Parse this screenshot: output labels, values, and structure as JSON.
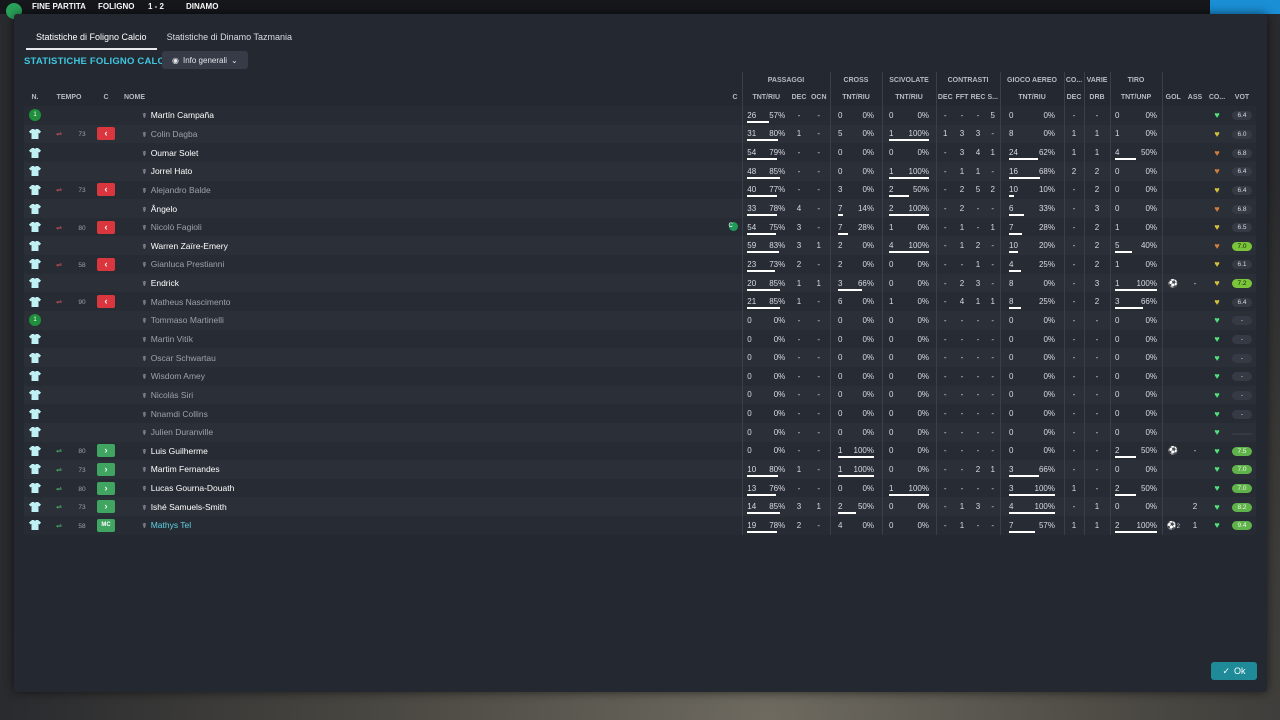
{
  "topbar": {
    "status": "FINE PARTITA",
    "home": "FOLIGNO",
    "score": "1 - 2",
    "away": "DINAMO"
  },
  "tabs": [
    {
      "label": "Statistiche di Foligno Calcio",
      "active": true
    },
    {
      "label": "Statistiche di Dinamo Tazmania",
      "active": false
    }
  ],
  "section_title": "STATISTICHE FOLIGNO CALCIO",
  "dropdown": {
    "label": "Info generali"
  },
  "groups": [
    "PASSAGGI",
    "CROSS",
    "SCIVOLATE",
    "CONTRASTI",
    "GIOCO AEREO",
    "CO...",
    "VARIE",
    "TIRO"
  ],
  "headers": {
    "n": "N.",
    "tempo": "TEMPO",
    "c": "C",
    "nome": "NOME",
    "c2": "C",
    "tnt_riu": "TNT/RIU",
    "dec": "DEC",
    "ocn": "OCN",
    "fft": "FFT",
    "rec": "REC",
    "s": "S...",
    "tnt_riu2": "TNT/RIU",
    "dec2": "DEC",
    "drb": "DRB",
    "tnt_unp": "TNT/UNP",
    "gol": "GOL",
    "ass": "ASS",
    "co": "CO...",
    "vot": "VOT"
  },
  "players": [
    {
      "n": "1",
      "gk": true,
      "tempo": "",
      "sub": "",
      "name": "Martín Campaña",
      "dim": false,
      "pt": "26",
      "pp": "57%",
      "pb": 0.57,
      "pdec": "-",
      "pocn": "-",
      "ct": "0",
      "cp": "0%",
      "cb": 0,
      "st": "0",
      "sp": "0%",
      "sb": 0,
      "cdec": "-",
      "cfft": "-",
      "crec": "-",
      "cs": "5",
      "at": "0",
      "ap": "0%",
      "ab": 0,
      "codec": "-",
      "drb": "-",
      "tt": "0",
      "tp": "0%",
      "tb": 0,
      "gol": "-",
      "ass": "",
      "co": "green",
      "vot": "6.4",
      "vcls": ""
    },
    {
      "n": "",
      "gk": false,
      "tempo": "73",
      "sub": "out",
      "name": "Colin Dagba",
      "dim": true,
      "pt": "31",
      "pp": "80%",
      "pb": 0.8,
      "pdec": "1",
      "pocn": "-",
      "ct": "5",
      "cp": "0%",
      "cb": 0,
      "st": "1",
      "sp": "100%",
      "sb": 1,
      "cdec": "1",
      "cfft": "3",
      "crec": "3",
      "cs": "-",
      "at": "8",
      "ap": "0%",
      "ab": 0,
      "codec": "1",
      "drb": "1",
      "tt": "1",
      "tp": "0%",
      "tb": 0,
      "gol": "-",
      "ass": "",
      "co": "yellow",
      "vot": "6.0",
      "vcls": ""
    },
    {
      "n": "",
      "gk": false,
      "tempo": "",
      "sub": "",
      "name": "Oumar Solet",
      "dim": false,
      "pt": "54",
      "pp": "79%",
      "pb": 0.79,
      "pdec": "-",
      "pocn": "-",
      "ct": "0",
      "cp": "0%",
      "cb": 0,
      "st": "0",
      "sp": "0%",
      "sb": 0,
      "cdec": "-",
      "cfft": "3",
      "crec": "4",
      "cs": "1",
      "at": "24",
      "ap": "62%",
      "ab": 0.62,
      "codec": "1",
      "drb": "1",
      "tt": "4",
      "tp": "50%",
      "tb": 0.5,
      "gol": "-",
      "ass": "",
      "co": "orange",
      "vot": "6.8",
      "vcls": ""
    },
    {
      "n": "",
      "gk": false,
      "tempo": "",
      "sub": "",
      "name": "Jorrel Hato",
      "dim": false,
      "pt": "48",
      "pp": "85%",
      "pb": 0.85,
      "pdec": "-",
      "pocn": "-",
      "ct": "0",
      "cp": "0%",
      "cb": 0,
      "st": "1",
      "sp": "100%",
      "sb": 1,
      "cdec": "-",
      "cfft": "1",
      "crec": "1",
      "cs": "-",
      "at": "16",
      "ap": "68%",
      "ab": 0.68,
      "codec": "2",
      "drb": "2",
      "tt": "0",
      "tp": "0%",
      "tb": 0,
      "gol": "-",
      "ass": "",
      "co": "orange",
      "vot": "6.4",
      "vcls": ""
    },
    {
      "n": "",
      "gk": false,
      "tempo": "73",
      "sub": "out",
      "name": "Alejandro Balde",
      "dim": true,
      "pt": "40",
      "pp": "77%",
      "pb": 0.77,
      "pdec": "-",
      "pocn": "-",
      "ct": "3",
      "cp": "0%",
      "cb": 0,
      "st": "2",
      "sp": "50%",
      "sb": 0.5,
      "cdec": "-",
      "cfft": "2",
      "crec": "5",
      "cs": "2",
      "at": "10",
      "ap": "10%",
      "ab": 0.1,
      "codec": "-",
      "drb": "2",
      "tt": "0",
      "tp": "0%",
      "tb": 0,
      "gol": "-",
      "ass": "",
      "co": "yellow",
      "vot": "6.4",
      "vcls": ""
    },
    {
      "n": "",
      "gk": false,
      "tempo": "",
      "sub": "",
      "name": "Ângelo",
      "dim": false,
      "pt": "33",
      "pp": "78%",
      "pb": 0.78,
      "pdec": "4",
      "pocn": "-",
      "ct": "7",
      "cp": "14%",
      "cb": 0.14,
      "st": "2",
      "sp": "100%",
      "sb": 1,
      "cdec": "-",
      "cfft": "2",
      "crec": "-",
      "cs": "-",
      "at": "6",
      "ap": "33%",
      "ab": 0.33,
      "codec": "-",
      "drb": "3",
      "tt": "0",
      "tp": "0%",
      "tb": 0,
      "gol": "-",
      "ass": "",
      "co": "orange",
      "vot": "6.8",
      "vcls": ""
    },
    {
      "n": "",
      "gk": false,
      "tempo": "80",
      "sub": "out",
      "name": "Nicolò Fagioli",
      "dim": true,
      "cicon": true,
      "pt": "54",
      "pp": "75%",
      "pb": 0.75,
      "pdec": "3",
      "pocn": "-",
      "ct": "7",
      "cp": "28%",
      "cb": 0.28,
      "st": "1",
      "sp": "0%",
      "sb": 0,
      "cdec": "-",
      "cfft": "1",
      "crec": "-",
      "cs": "1",
      "at": "7",
      "ap": "28%",
      "ab": 0.28,
      "codec": "-",
      "drb": "2",
      "tt": "1",
      "tp": "0%",
      "tb": 0,
      "gol": "-",
      "ass": "",
      "co": "yellow",
      "vot": "6.5",
      "vcls": ""
    },
    {
      "n": "",
      "gk": false,
      "tempo": "",
      "sub": "",
      "name": "Warren Zaïre-Emery",
      "dim": false,
      "pt": "59",
      "pp": "83%",
      "pb": 0.83,
      "pdec": "3",
      "pocn": "1",
      "ct": "2",
      "cp": "0%",
      "cb": 0,
      "st": "4",
      "sp": "100%",
      "sb": 1,
      "cdec": "-",
      "cfft": "1",
      "crec": "2",
      "cs": "-",
      "at": "10",
      "ap": "20%",
      "ab": 0.2,
      "codec": "-",
      "drb": "2",
      "tt": "5",
      "tp": "40%",
      "tb": 0.4,
      "gol": "-",
      "ass": "",
      "co": "orange",
      "vot": "7.0",
      "vcls": "lg"
    },
    {
      "n": "",
      "gk": false,
      "tempo": "58",
      "sub": "out",
      "name": "Gianluca Prestianni",
      "dim": true,
      "pt": "23",
      "pp": "73%",
      "pb": 0.73,
      "pdec": "2",
      "pocn": "-",
      "ct": "2",
      "cp": "0%",
      "cb": 0,
      "st": "0",
      "sp": "0%",
      "sb": 0,
      "cdec": "-",
      "cfft": "-",
      "crec": "1",
      "cs": "-",
      "at": "4",
      "ap": "25%",
      "ab": 0.25,
      "codec": "-",
      "drb": "2",
      "tt": "1",
      "tp": "0%",
      "tb": 0,
      "gol": "-",
      "ass": "",
      "co": "yellow",
      "vot": "6.1",
      "vcls": ""
    },
    {
      "n": "",
      "gk": false,
      "tempo": "",
      "sub": "",
      "name": "Endrick",
      "dim": false,
      "pt": "20",
      "pp": "85%",
      "pb": 0.85,
      "pdec": "1",
      "pocn": "1",
      "ct": "3",
      "cp": "66%",
      "cb": 0.66,
      "st": "0",
      "sp": "0%",
      "sb": 0,
      "cdec": "-",
      "cfft": "2",
      "crec": "3",
      "cs": "-",
      "at": "8",
      "ap": "0%",
      "ab": 0,
      "codec": "-",
      "drb": "3",
      "tt": "1",
      "tp": "100%",
      "tb": 1,
      "gol": "ball",
      "ass": "-",
      "co": "yellow",
      "vot": "7.2",
      "vcls": "lg"
    },
    {
      "n": "",
      "gk": false,
      "tempo": "90",
      "sub": "out",
      "name": "Matheus Nascimento",
      "dim": true,
      "pt": "21",
      "pp": "85%",
      "pb": 0.85,
      "pdec": "1",
      "pocn": "-",
      "ct": "6",
      "cp": "0%",
      "cb": 0,
      "st": "1",
      "sp": "0%",
      "sb": 0,
      "cdec": "-",
      "cfft": "4",
      "crec": "1",
      "cs": "1",
      "at": "8",
      "ap": "25%",
      "ab": 0.25,
      "codec": "-",
      "drb": "2",
      "tt": "3",
      "tp": "66%",
      "tb": 0.66,
      "gol": "-",
      "ass": "",
      "co": "yellow",
      "vot": "6.4",
      "vcls": ""
    },
    {
      "n": "1",
      "gk": true,
      "tempo": "",
      "sub": "",
      "name": "Tommaso Martinelli",
      "dim": true,
      "pt": "0",
      "pp": "0%",
      "pb": 0,
      "pdec": "-",
      "pocn": "-",
      "ct": "0",
      "cp": "0%",
      "cb": 0,
      "st": "0",
      "sp": "0%",
      "sb": 0,
      "cdec": "-",
      "cfft": "-",
      "crec": "-",
      "cs": "-",
      "at": "0",
      "ap": "0%",
      "ab": 0,
      "codec": "-",
      "drb": "-",
      "tt": "0",
      "tp": "0%",
      "tb": 0,
      "gol": "-",
      "ass": "",
      "co": "green",
      "vot": "-",
      "vcls": ""
    },
    {
      "n": "",
      "gk": false,
      "tempo": "",
      "sub": "",
      "name": "Martin Vitík",
      "dim": true,
      "pt": "0",
      "pp": "0%",
      "pb": 0,
      "pdec": "-",
      "pocn": "-",
      "ct": "0",
      "cp": "0%",
      "cb": 0,
      "st": "0",
      "sp": "0%",
      "sb": 0,
      "cdec": "-",
      "cfft": "-",
      "crec": "-",
      "cs": "-",
      "at": "0",
      "ap": "0%",
      "ab": 0,
      "codec": "-",
      "drb": "-",
      "tt": "0",
      "tp": "0%",
      "tb": 0,
      "gol": "-",
      "ass": "",
      "co": "green",
      "vot": "-",
      "vcls": ""
    },
    {
      "n": "",
      "gk": false,
      "tempo": "",
      "sub": "",
      "name": "Oscar Schwartau",
      "dim": true,
      "pt": "0",
      "pp": "0%",
      "pb": 0,
      "pdec": "-",
      "pocn": "-",
      "ct": "0",
      "cp": "0%",
      "cb": 0,
      "st": "0",
      "sp": "0%",
      "sb": 0,
      "cdec": "-",
      "cfft": "-",
      "crec": "-",
      "cs": "-",
      "at": "0",
      "ap": "0%",
      "ab": 0,
      "codec": "-",
      "drb": "-",
      "tt": "0",
      "tp": "0%",
      "tb": 0,
      "gol": "-",
      "ass": "",
      "co": "green",
      "vot": "-",
      "vcls": ""
    },
    {
      "n": "",
      "gk": false,
      "tempo": "",
      "sub": "",
      "name": "Wisdom Amey",
      "dim": true,
      "pt": "0",
      "pp": "0%",
      "pb": 0,
      "pdec": "-",
      "pocn": "-",
      "ct": "0",
      "cp": "0%",
      "cb": 0,
      "st": "0",
      "sp": "0%",
      "sb": 0,
      "cdec": "-",
      "cfft": "-",
      "crec": "-",
      "cs": "-",
      "at": "0",
      "ap": "0%",
      "ab": 0,
      "codec": "-",
      "drb": "-",
      "tt": "0",
      "tp": "0%",
      "tb": 0,
      "gol": "-",
      "ass": "",
      "co": "green",
      "vot": "-",
      "vcls": ""
    },
    {
      "n": "",
      "gk": false,
      "tempo": "",
      "sub": "",
      "name": "Nicolás Siri",
      "dim": true,
      "pt": "0",
      "pp": "0%",
      "pb": 0,
      "pdec": "-",
      "pocn": "-",
      "ct": "0",
      "cp": "0%",
      "cb": 0,
      "st": "0",
      "sp": "0%",
      "sb": 0,
      "cdec": "-",
      "cfft": "-",
      "crec": "-",
      "cs": "-",
      "at": "0",
      "ap": "0%",
      "ab": 0,
      "codec": "-",
      "drb": "-",
      "tt": "0",
      "tp": "0%",
      "tb": 0,
      "gol": "-",
      "ass": "",
      "co": "green",
      "vot": "-",
      "vcls": ""
    },
    {
      "n": "",
      "gk": false,
      "tempo": "",
      "sub": "",
      "name": "Nnamdi Collins",
      "dim": true,
      "pt": "0",
      "pp": "0%",
      "pb": 0,
      "pdec": "-",
      "pocn": "-",
      "ct": "0",
      "cp": "0%",
      "cb": 0,
      "st": "0",
      "sp": "0%",
      "sb": 0,
      "cdec": "-",
      "cfft": "-",
      "crec": "-",
      "cs": "-",
      "at": "0",
      "ap": "0%",
      "ab": 0,
      "codec": "-",
      "drb": "-",
      "tt": "0",
      "tp": "0%",
      "tb": 0,
      "gol": "-",
      "ass": "",
      "co": "green",
      "vot": "-",
      "vcls": ""
    },
    {
      "n": "",
      "gk": false,
      "tempo": "",
      "sub": "",
      "name": "Julien Duranville",
      "dim": true,
      "pt": "0",
      "pp": "0%",
      "pb": 0,
      "pdec": "-",
      "pocn": "-",
      "ct": "0",
      "cp": "0%",
      "cb": 0,
      "st": "0",
      "sp": "0%",
      "sb": 0,
      "cdec": "-",
      "cfft": "-",
      "crec": "-",
      "cs": "-",
      "at": "0",
      "ap": "0%",
      "ab": 0,
      "codec": "-",
      "drb": "-",
      "tt": "0",
      "tp": "0%",
      "tb": 0,
      "gol": "-",
      "ass": "",
      "co": "green",
      "vot": "",
      "vcls": ""
    },
    {
      "n": "",
      "gk": false,
      "tempo": "80",
      "sub": "in",
      "name": "Luis Guilherme",
      "dim": false,
      "pt": "0",
      "pp": "0%",
      "pb": 0,
      "pdec": "-",
      "pocn": "-",
      "ct": "1",
      "cp": "100%",
      "cb": 1,
      "st": "0",
      "sp": "0%",
      "sb": 0,
      "cdec": "-",
      "cfft": "-",
      "crec": "-",
      "cs": "-",
      "at": "0",
      "ap": "0%",
      "ab": 0,
      "codec": "-",
      "drb": "-",
      "tt": "2",
      "tp": "50%",
      "tb": 0.5,
      "gol": "ball",
      "ass": "-",
      "co": "green",
      "vot": "7.5",
      "vcls": "g"
    },
    {
      "n": "",
      "gk": false,
      "tempo": "73",
      "sub": "in",
      "name": "Martim Fernandes",
      "dim": false,
      "pt": "10",
      "pp": "80%",
      "pb": 0.8,
      "pdec": "1",
      "pocn": "-",
      "ct": "1",
      "cp": "100%",
      "cb": 1,
      "st": "0",
      "sp": "0%",
      "sb": 0,
      "cdec": "-",
      "cfft": "-",
      "crec": "2",
      "cs": "1",
      "at": "3",
      "ap": "66%",
      "ab": 0.66,
      "codec": "-",
      "drb": "-",
      "tt": "0",
      "tp": "0%",
      "tb": 0,
      "gol": "-",
      "ass": "",
      "co": "green",
      "vot": "7.0",
      "vcls": "g"
    },
    {
      "n": "",
      "gk": false,
      "tempo": "80",
      "sub": "in",
      "name": "Lucas Gourna-Douath",
      "dim": false,
      "pt": "13",
      "pp": "76%",
      "pb": 0.76,
      "pdec": "-",
      "pocn": "-",
      "ct": "0",
      "cp": "0%",
      "cb": 0,
      "st": "1",
      "sp": "100%",
      "sb": 1,
      "cdec": "-",
      "cfft": "-",
      "crec": "-",
      "cs": "-",
      "at": "3",
      "ap": "100%",
      "ab": 1,
      "codec": "1",
      "drb": "-",
      "tt": "2",
      "tp": "50%",
      "tb": 0.5,
      "gol": "-",
      "ass": "",
      "co": "green",
      "vot": "7.0",
      "vcls": "g"
    },
    {
      "n": "",
      "gk": false,
      "tempo": "73",
      "sub": "in",
      "name": "Ishé Samuels-Smith",
      "dim": false,
      "pt": "14",
      "pp": "85%",
      "pb": 0.85,
      "pdec": "3",
      "pocn": "1",
      "ct": "2",
      "cp": "50%",
      "cb": 0.5,
      "st": "0",
      "sp": "0%",
      "sb": 0,
      "cdec": "-",
      "cfft": "1",
      "crec": "3",
      "cs": "-",
      "at": "4",
      "ap": "100%",
      "ab": 1,
      "codec": "-",
      "drb": "1",
      "tt": "0",
      "tp": "0%",
      "tb": 0,
      "gol": "",
      "ass": "2",
      "co": "green",
      "vot": "8.2",
      "vcls": "g"
    },
    {
      "n": "",
      "gk": false,
      "tempo": "58",
      "sub": "mc",
      "name": "Mathys Tel",
      "dim": false,
      "hl": true,
      "pt": "19",
      "pp": "78%",
      "pb": 0.78,
      "pdec": "2",
      "pocn": "-",
      "ct": "4",
      "cp": "0%",
      "cb": 0,
      "st": "0",
      "sp": "0%",
      "sb": 0,
      "cdec": "-",
      "cfft": "1",
      "crec": "-",
      "cs": "-",
      "at": "7",
      "ap": "57%",
      "ab": 0.57,
      "codec": "1",
      "drb": "1",
      "tt": "2",
      "tp": "100%",
      "tb": 1,
      "gol": "ball2",
      "ass": "1",
      "co": "green",
      "vot": "9.4",
      "vcls": "g"
    }
  ],
  "sub_labels": {
    "mc": "MC"
  },
  "colors": {
    "accent": "#3fc6e0",
    "green": "#4fe27a",
    "yellow": "#d6c23a",
    "orange": "#d08a3a",
    "sub_out": "#d9363e",
    "sub_in": "#3fa560",
    "ok": "#1f8b99"
  },
  "ok_label": "Ok"
}
